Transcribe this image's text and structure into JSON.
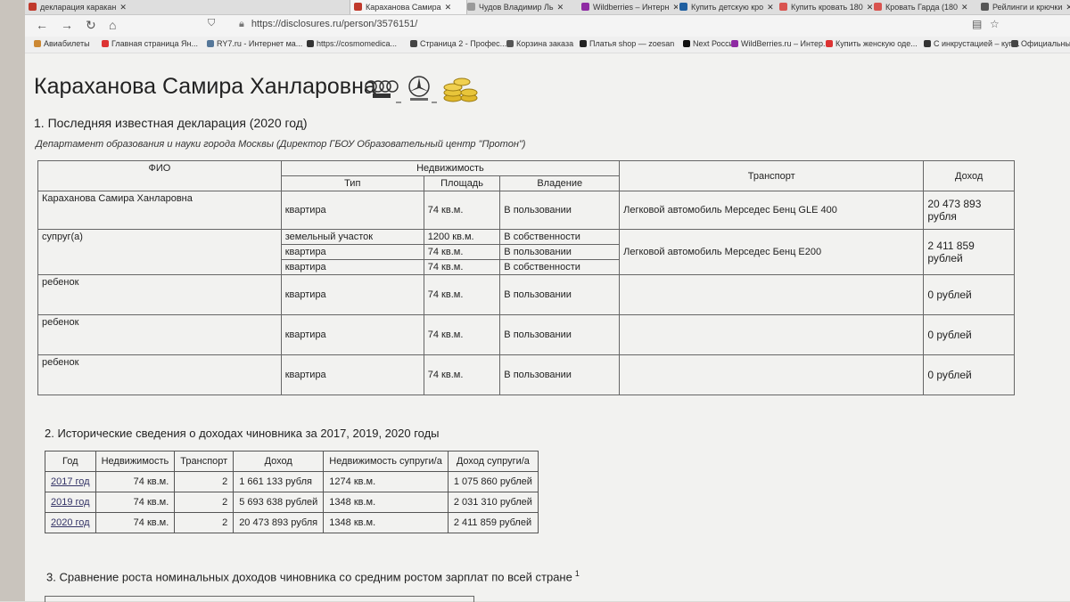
{
  "tabs": [
    {
      "label": "декларация каракан",
      "icon_color": "#c0392b",
      "active": false
    },
    {
      "label": "Караханова Самира",
      "icon_color": "#c0392b",
      "active": true
    },
    {
      "label": "Чудов Владимир Ль",
      "icon_color": "#999999",
      "active": false
    },
    {
      "label": "Wildberries – Интерн",
      "icon_color": "#8e2aa3",
      "active": false
    },
    {
      "label": "Купить детскую кро",
      "icon_color": "#1f5fa0",
      "active": false
    },
    {
      "label": "Купить кровать 180",
      "icon_color": "#d9534f",
      "active": false
    },
    {
      "label": "Кровать Гарда (180",
      "icon_color": "#d9534f",
      "active": false
    },
    {
      "label": "Рейлинги и крючки",
      "icon_color": "#555555",
      "active": false
    }
  ],
  "nav": {
    "url": "https://disclosures.ru/person/3576151/"
  },
  "bookmarks": [
    "Авиабилеты",
    "Главная страница Ян...",
    "RY7.ru - Интернет ма...",
    "https://cosmomedica...",
    "Страница 2 - Профес...",
    "Корзина заказа",
    "Платья shop — zoesan",
    "Next Россия",
    "WildBerries.ru – Интер...",
    "Купить женскую оде...",
    "С инкрустацией – куп...",
    "Официальный"
  ],
  "page": {
    "title": "Караханова Самира Ханларовна",
    "section1": "1. Последняя известная декларация (2020 год)",
    "department": "Департамент образования и науки города Москвы (Директор ГБОУ Образовательный центр \"Протон\")",
    "section2": "2. Исторические сведения о доходах чиновника за 2017, 2019, 2020 годы",
    "section3": "3. Сравнение роста номинальных доходов чиновника со средним ростом зарплат по всей стране",
    "section3_sup": "1"
  },
  "declaration": {
    "headers": {
      "fio": "ФИО",
      "realty": "Недвижимость",
      "type": "Тип",
      "area": "Площадь",
      "ownership": "Владение",
      "transport": "Транспорт",
      "income": "Доход"
    },
    "rows": [
      {
        "fio": "Караханова Самира Ханларовна",
        "items": [
          {
            "type": "квартира",
            "area": "74 кв.м.",
            "own": "В пользовании"
          }
        ],
        "transport": "Легковой автомобиль Мерседес Бенц GLE 400",
        "income": "20 473 893 рубля"
      },
      {
        "fio": "супруг(а)",
        "items": [
          {
            "type": "земельный участок",
            "area": "1200 кв.м.",
            "own": "В собственности"
          },
          {
            "type": "квартира",
            "area": "74 кв.м.",
            "own": "В пользовании"
          },
          {
            "type": "квартира",
            "area": "74 кв.м.",
            "own": "В собственности"
          }
        ],
        "transport": "Легковой автомобиль Мерседес Бенц Е200",
        "income": "2 411 859 рублей"
      },
      {
        "fio": "ребенок",
        "items": [
          {
            "type": "квартира",
            "area": "74 кв.м.",
            "own": "В пользовании"
          }
        ],
        "transport": "",
        "income": "0 рублей"
      },
      {
        "fio": "ребенок",
        "items": [
          {
            "type": "квартира",
            "area": "74 кв.м.",
            "own": "В пользовании"
          }
        ],
        "transport": "",
        "income": "0 рублей"
      },
      {
        "fio": "ребенок",
        "items": [
          {
            "type": "квартира",
            "area": "74 кв.м.",
            "own": "В пользовании"
          }
        ],
        "transport": "",
        "income": "0 рублей"
      }
    ]
  },
  "history": {
    "headers": [
      "Год",
      "Недвижимость",
      "Транспорт",
      "Доход",
      "Недвижимость супруги/а",
      "Доход супруги/а"
    ],
    "rows": [
      [
        "2017 год",
        "74 кв.м.",
        "2",
        "1 661 133 рубля",
        "1274 кв.м.",
        "1 075 860 рублей"
      ],
      [
        "2019 год",
        "74 кв.м.",
        "2",
        "5 693 638 рублей",
        "1348 кв.м.",
        "2 031 310 рублей"
      ],
      [
        "2020 год",
        "74 кв.м.",
        "2",
        "20 473 893 рубля",
        "1348 кв.м.",
        "2 411 859 рублей"
      ]
    ]
  }
}
